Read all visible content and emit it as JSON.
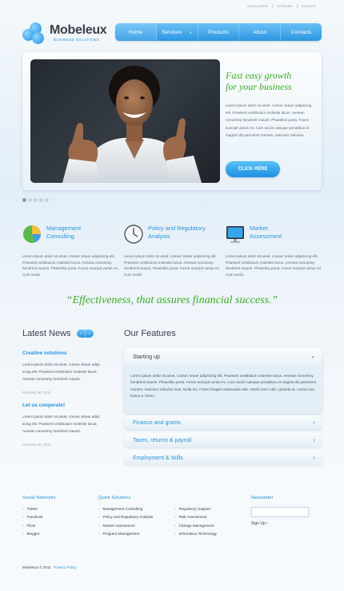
{
  "toplinks": [
    "USER AREA",
    "SITEMAP",
    "SEARCH"
  ],
  "logo": {
    "name": "Mobeleux",
    "tagline": "BUSINESS SOLUTIONS"
  },
  "nav": {
    "items": [
      "Home",
      "Services",
      "Products",
      "About",
      "Contacts"
    ],
    "active": "Home"
  },
  "hero": {
    "title_line1": "Fast easy growth",
    "title_line2": "for your business",
    "text": "Lorem ipsum dolor sit amet, consec tetuer adipiscing elit. Praesent vestibulum molestie lacus. Aenean nonummy hendrerit mauris. Phasellus porta. Fusce suscipit varius mi. Cum sociis natoque penatibus et magnis dis parturient montes, nascetur ridiculus.",
    "button": "CLICK HERE"
  },
  "slider_dots": {
    "count": 5,
    "active": 0
  },
  "services": [
    {
      "title_line1": "Management",
      "title_line2": "Consulting",
      "icon": "pie-chart-icon",
      "text": "Lorem ipsum dolor sit amet, consec tetuer adipiscing elit. Praesent vestibulum molestie lacus. Aenean nonummy hendrerit mauris. Phasellus porta. Fusce suscipit varius mi. Cum sociis"
    },
    {
      "title_line1": "Policy and Regulatory",
      "title_line2": "Analysis",
      "icon": "clock-icon",
      "text": "Lorem ipsum dolor sit amet, consec tetuer adipiscing elit. Praesent vestibulum molestie lacus. Aenean nonummy hendrerit mauris. Phasellus porta. Fusce suscipit varius mi. Cum sociis"
    },
    {
      "title_line1": "Market",
      "title_line2": "Assessment",
      "icon": "monitor-icon",
      "text": "Lorem ipsum dolor sit amet, consec tetuer adipiscing elit. Praesent vestibulum molestie lacus. Aenean nonummy hendrerit mauris. Phasellus porta. Fusce suscipit varius mi. Cum sociis"
    }
  ],
  "quote": "“Effectiveness, that assures financial success.”",
  "news": {
    "heading": "Latest News",
    "prev": "‹",
    "next": "›",
    "items": [
      {
        "title": "Creative solutions",
        "text": "Lorem ipsum dolor sit amet, consec tetuer adipi scing elit. Praesent vestibulum molestie lacus. Aenean nonummy hendrerit mauris.",
        "date": "February 30, 2011"
      },
      {
        "title": "Let us cooperate!",
        "text": "Lorem ipsum dolor sit amet, consec tetuer adipi scing elit. Praesent vestibulum molestie lacus. Aenean nonummy hendrerit mauris.",
        "date": "February 30, 2011"
      }
    ]
  },
  "features": {
    "heading": "Our Features",
    "open": {
      "title": "Starting up",
      "text": "Lorem ipsum dolor sit amet, consec tetuer adipiscing elit. Praesent vestibulum molestie lacus. Aenean nonummy hendrerit mauris. Phasellus porta. Fusce suscipit varius mi. Cum sociis natoque penatibus et magnis dis parturient montes, nascetur ridiculus mus. Nulla dui. Fusce feugiat malesuada odio. Morbi nunc odio, gravida at, cursus nec, luctus a, lorem."
    },
    "closed": [
      "Finance and grants",
      "Taxes, returns & payroll",
      "Employment & skills"
    ]
  },
  "footer": {
    "social": {
      "heading": "Social Networks",
      "items": [
        "Twitter",
        "Facebook",
        "Flickr",
        "Blogger"
      ]
    },
    "quick": {
      "heading": "Quick Solutions",
      "col1": [
        "Management Consulting",
        "Policy and Regulatory Analysis",
        "Market Assessment",
        "Program Management"
      ],
      "col2": [
        "Regulatory Support",
        "Risk Assessment",
        "Change Management",
        "Information Technology"
      ]
    },
    "newsletter": {
      "heading": "Newsletter",
      "sign_up": "Sign Up ›"
    },
    "copyright": "Mobeleux © 2011",
    "privacy": "Privacy Policy"
  }
}
